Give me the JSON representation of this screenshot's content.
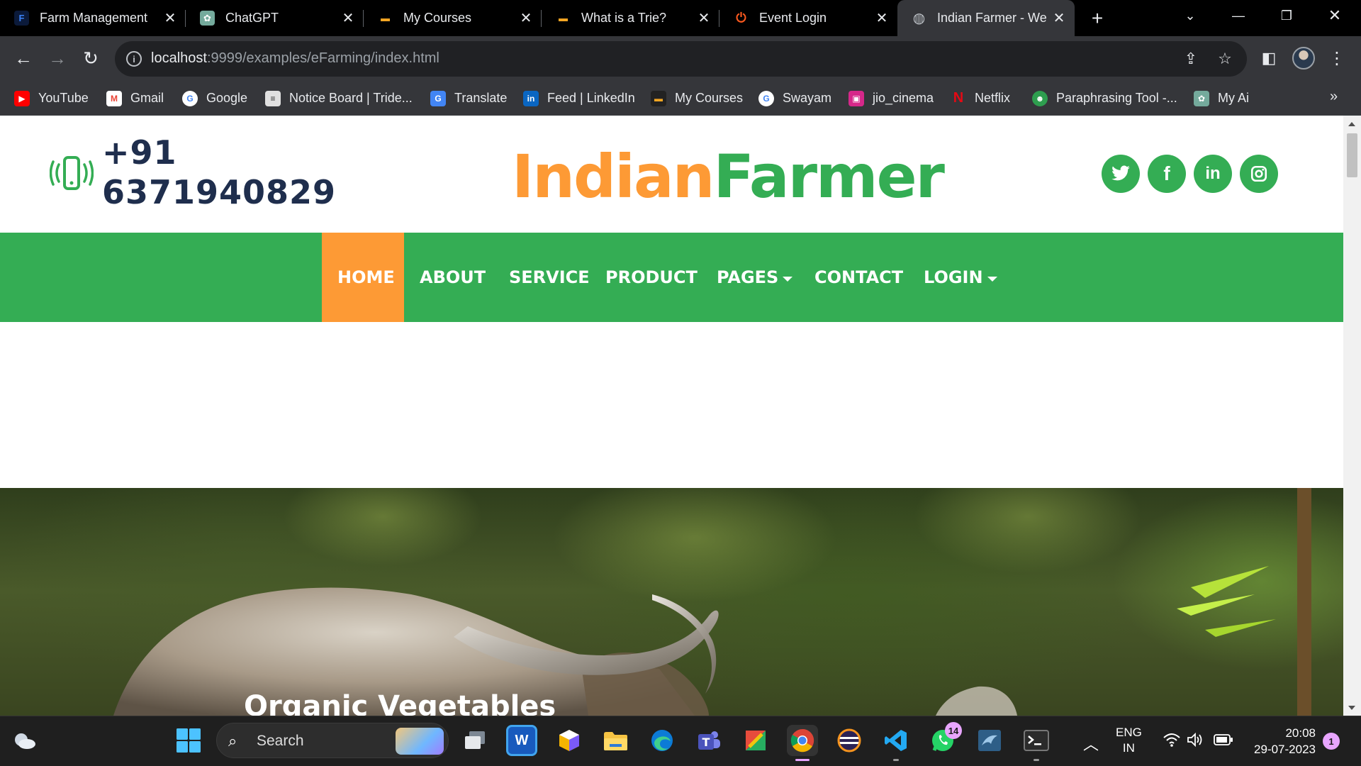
{
  "browser": {
    "tabs": [
      {
        "title": "Farm Management",
        "icon": "F",
        "icon_bg": "#0b1a3a",
        "icon_color": "#3b82f6"
      },
      {
        "title": "ChatGPT",
        "icon": "✿",
        "icon_bg": "#74aa9c",
        "icon_color": "#ffffff"
      },
      {
        "title": "My Courses",
        "icon": "▬",
        "icon_bg": "#000000",
        "icon_color": "#f5a623"
      },
      {
        "title": "What is a Trie?",
        "icon": "▬",
        "icon_bg": "#000000",
        "icon_color": "#f5a623"
      },
      {
        "title": "Event Login",
        "icon": "⏻",
        "icon_bg": "#000000",
        "icon_color": "#ff5a1f"
      },
      {
        "title": "Indian Farmer - We",
        "icon": "◍",
        "icon_bg": "#35363a",
        "icon_color": "#bdc1c6"
      }
    ],
    "address": {
      "host": "localhost",
      "path": ":9999/examples/eFarming/index.html"
    },
    "bookmarks": [
      {
        "label": "YouTube",
        "icon": "▶",
        "color": "#ff0000"
      },
      {
        "label": "Gmail",
        "icon": "M",
        "color": "#ea4335"
      },
      {
        "label": "Google",
        "icon": "G",
        "color": "#4285f4"
      },
      {
        "label": "Notice Board | Tride...",
        "icon": "≡",
        "color": "#555555"
      },
      {
        "label": "Translate",
        "icon": "G",
        "color": "#4285f4"
      },
      {
        "label": "Feed | LinkedIn",
        "icon": "in",
        "color": "#0a66c2"
      },
      {
        "label": "My Courses",
        "icon": "▬",
        "color": "#222222"
      },
      {
        "label": "Swayam",
        "icon": "G",
        "color": "#4285f4"
      },
      {
        "label": "jio_cinema",
        "icon": "▣",
        "color": "#d6288a"
      },
      {
        "label": "Netflix",
        "icon": "N",
        "color": "#e50914"
      },
      {
        "label": "Paraphrasing Tool -...",
        "icon": "☻",
        "color": "#2e9e4f"
      },
      {
        "label": "My Ai",
        "icon": "✿",
        "color": "#74aa9c"
      }
    ]
  },
  "site": {
    "phone": [
      "+91",
      "6371940829"
    ],
    "brand": {
      "part1": "Indian",
      "part2": "Farmer"
    },
    "social": [
      {
        "name": "twitter",
        "glyph": "t"
      },
      {
        "name": "facebook",
        "glyph": "f"
      },
      {
        "name": "linkedin",
        "glyph": "in"
      },
      {
        "name": "instagram",
        "glyph": "◎"
      }
    ],
    "nav": [
      {
        "label": "HOME",
        "active": true
      },
      {
        "label": "ABOUT"
      },
      {
        "label": "SERVICE"
      },
      {
        "label": "PRODUCT"
      },
      {
        "label": "PAGES",
        "dropdown": true
      },
      {
        "label": "CONTACT"
      },
      {
        "label": "LOGIN",
        "dropdown": true
      }
    ],
    "hero_title": "Organic Vegetables",
    "colors": {
      "orange": "#fd9a35",
      "green": "#34ad54",
      "navy": "#1f2e4d"
    }
  },
  "taskbar": {
    "search_label": "Search",
    "whatsapp_badge": "14",
    "lang": [
      "ENG",
      "IN"
    ],
    "time": "20:08",
    "date": "29-07-2023",
    "notif_count": "1"
  }
}
